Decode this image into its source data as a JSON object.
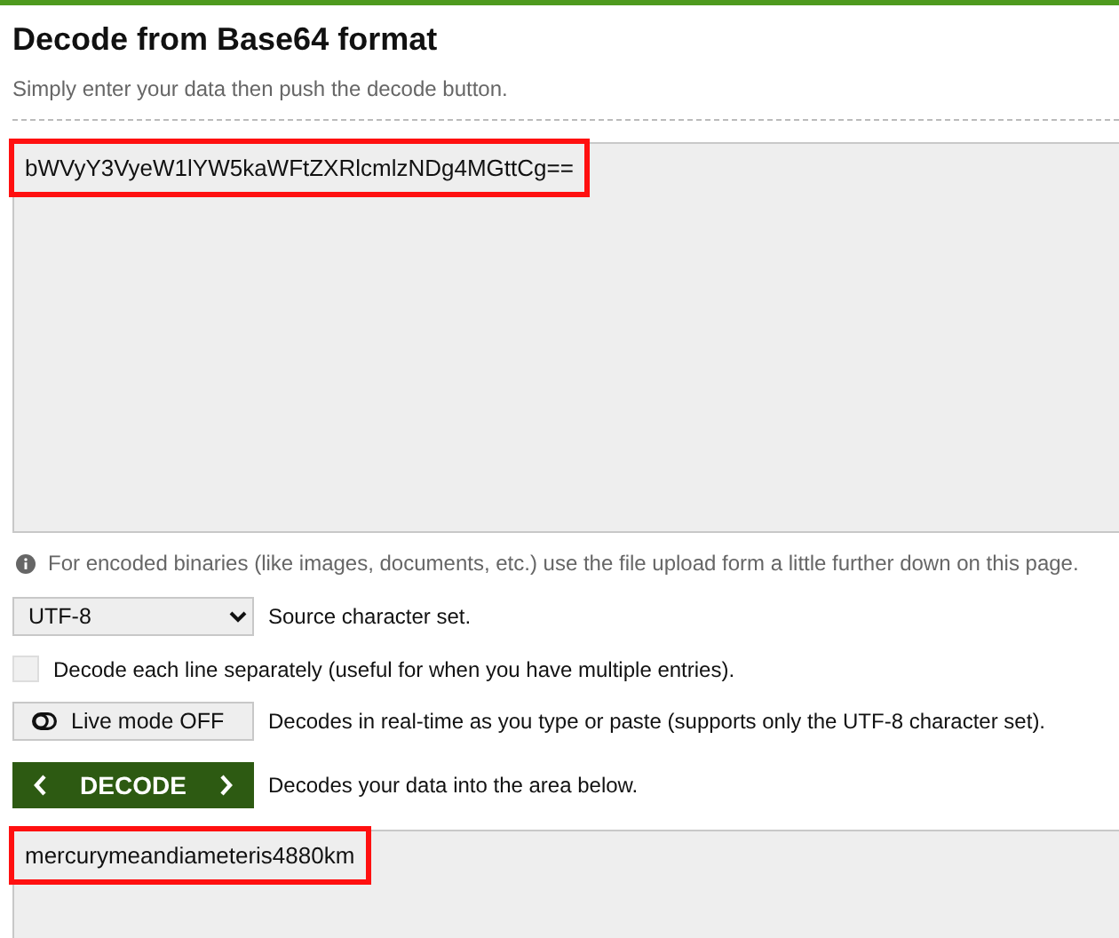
{
  "title": "Decode from Base64 format",
  "subtitle": "Simply enter your data then push the decode button.",
  "input": {
    "value": "bWVyY3VyeW1lYW5kaWFtZXRlcmlzNDg4MGttCg==",
    "highlighted": true
  },
  "info": "For encoded binaries (like images, documents, etc.) use the file upload form a little further down on this page.",
  "charset": {
    "value": "UTF-8",
    "label": "Source character set."
  },
  "line_option": {
    "label": "Decode each line separately (useful for when you have multiple entries).",
    "checked": false
  },
  "live_mode": {
    "label": "Live mode OFF",
    "on": false,
    "description": "Decodes in real-time as you type or paste (supports only the UTF-8 character set)."
  },
  "decode": {
    "label": "DECODE",
    "description": "Decodes your data into the area below."
  },
  "output": {
    "value": "mercurymeandiameteris4880km",
    "highlighted": true
  }
}
